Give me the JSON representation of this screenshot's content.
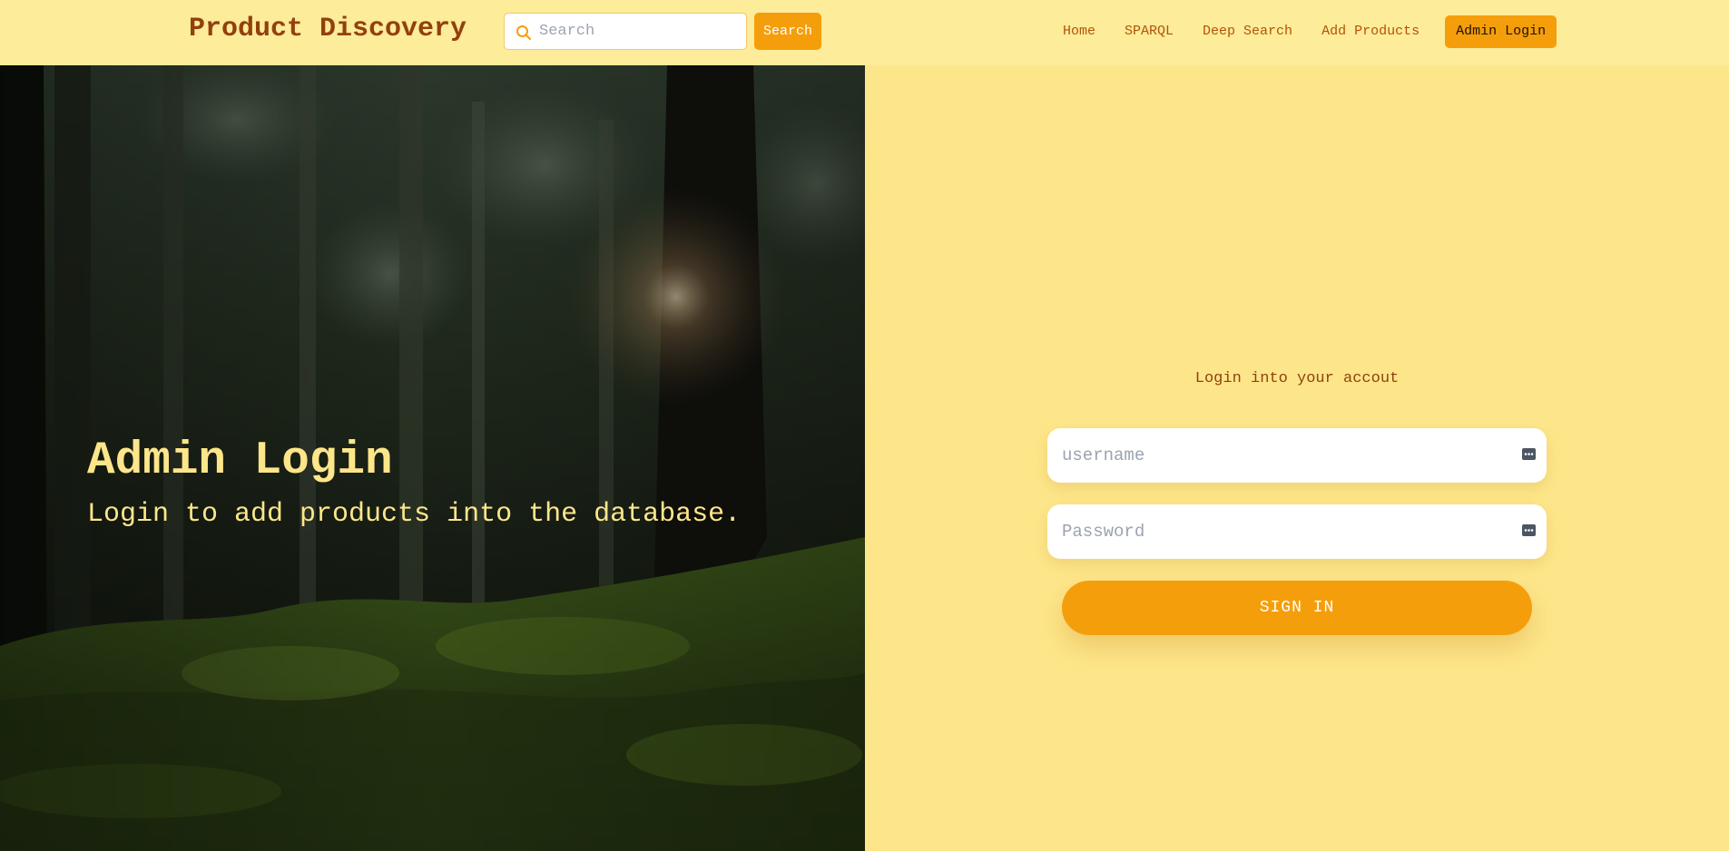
{
  "navbar": {
    "brand": "Product Discovery",
    "search_placeholder": "Search",
    "search_button": "Search",
    "links": [
      {
        "label": "Home"
      },
      {
        "label": "SPARQL"
      },
      {
        "label": "Deep Search"
      },
      {
        "label": "Add Products"
      },
      {
        "label": "Admin Login",
        "active": true
      }
    ]
  },
  "hero": {
    "title": "Admin Login",
    "subtitle": "Login to add products into the database."
  },
  "login": {
    "caption": "Login into your accout",
    "username_placeholder": "username",
    "password_placeholder": "Password",
    "submit_label": "SIGN IN"
  },
  "icons": {
    "search": "search-icon",
    "username_field": "password-manager-key-icon",
    "password_field": "password-manager-key-icon"
  },
  "colors": {
    "page_background": "#fde68a",
    "navbar_background": "#fdec9a",
    "accent": "#f59e0b",
    "brand_text": "#92400e",
    "link_text": "#b45309",
    "hero_text": "#fde68a"
  }
}
